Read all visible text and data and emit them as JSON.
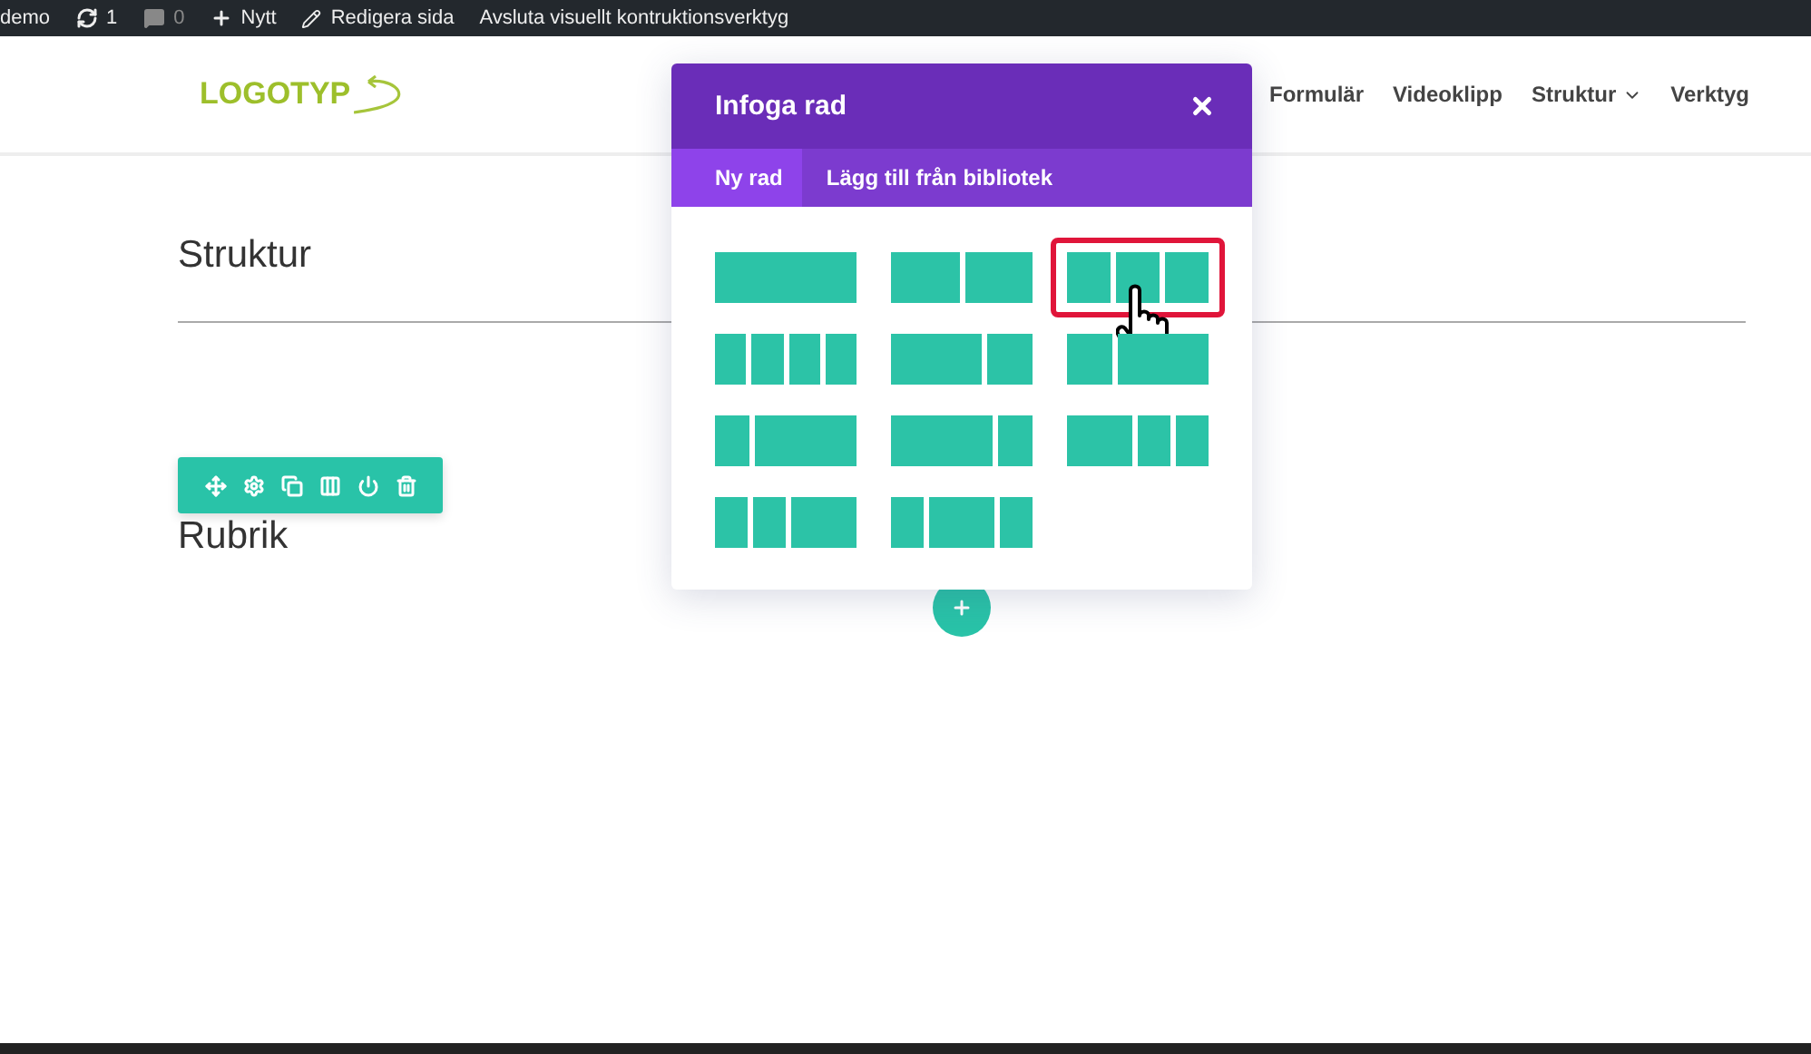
{
  "admin_bar": [
    {
      "kind": "site",
      "label": "demo"
    },
    {
      "kind": "updates",
      "label": "1"
    },
    {
      "kind": "comments",
      "label": "0"
    },
    {
      "kind": "new",
      "label": "Nytt"
    },
    {
      "kind": "edit",
      "label": "Redigera sida"
    },
    {
      "kind": "site",
      "label": "Avsluta visuellt kontruktionsverktyg"
    }
  ],
  "logo": "LOGOTYP",
  "nav": [
    {
      "label": "Formulär",
      "has_menu": false
    },
    {
      "label": "Videoklipp",
      "has_menu": false
    },
    {
      "label": "Struktur",
      "has_menu": true
    },
    {
      "label": "Verktyg",
      "has_menu": false
    }
  ],
  "content": {
    "heading": "Struktur",
    "module_heading": "Rubrik"
  },
  "modal": {
    "title": "Infoga rad",
    "tabs": [
      {
        "label": "Ny rad",
        "selected": true
      },
      {
        "label": "Lägg till från bibliotek",
        "selected": false
      }
    ],
    "layouts": [
      {
        "kind": "single",
        "selected": false
      },
      {
        "kind": "halves",
        "selected": false
      },
      {
        "kind": "thirds",
        "selected": true
      },
      {
        "kind": "quarters",
        "selected": false
      },
      {
        "kind": "wideleft",
        "selected": false
      },
      {
        "kind": "wideright",
        "selected": false
      },
      {
        "kind": "quarterleft",
        "selected": false
      },
      {
        "kind": "quarterright",
        "selected": false
      },
      {
        "kind": "halfleft",
        "selected": false
      },
      {
        "kind": "halfright",
        "selected": false
      },
      {
        "kind": "halfcenter",
        "selected": false
      }
    ]
  }
}
